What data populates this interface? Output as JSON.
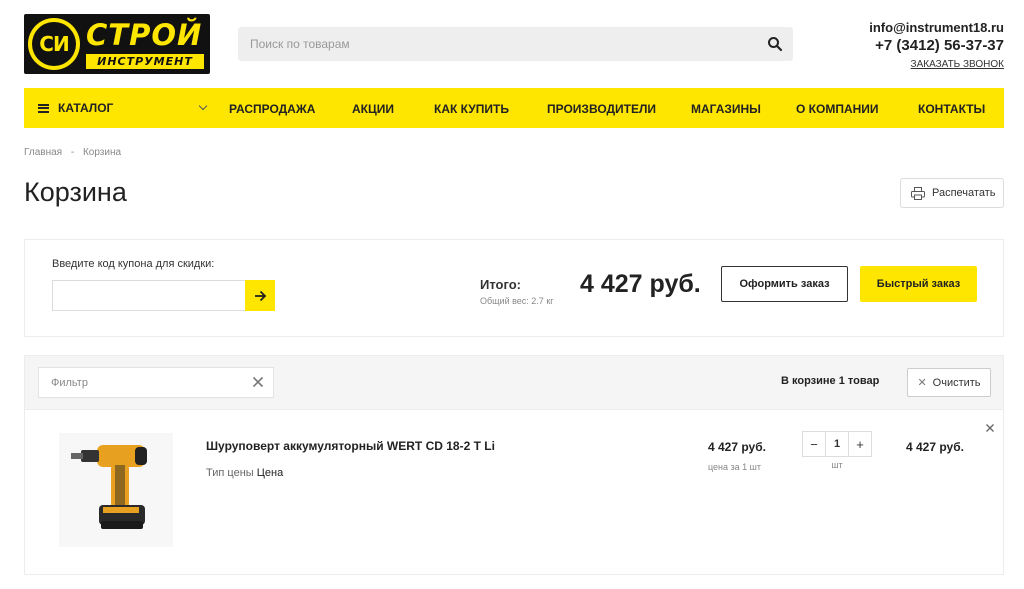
{
  "logo": {
    "emblem": "СИ",
    "line1": "СТРОЙ",
    "line2": "ИНСТРУМЕНТ"
  },
  "search": {
    "placeholder": "Поиск по товарам",
    "icon": "search-icon"
  },
  "contacts": {
    "email": "info@instrument18.ru",
    "phone": "+7 (3412) 56-37-37",
    "callback": "ЗАКАЗАТЬ ЗВОНОК"
  },
  "nav": {
    "catalog": "КАТАЛОГ",
    "items": [
      "РАСПРОДАЖА",
      "АКЦИИ",
      "КАК КУПИТЬ",
      "ПРОИЗВОДИТЕЛИ",
      "МАГАЗИНЫ",
      "О КОМПАНИИ",
      "КОНТАКТЫ"
    ]
  },
  "breadcrumb": {
    "home": "Главная",
    "separator": "-",
    "current": "Корзина"
  },
  "page": {
    "title": "Корзина",
    "print": "Распечатать"
  },
  "coupon": {
    "label": "Введите код купона для скидки:",
    "value": ""
  },
  "summary": {
    "total_label": "Итого:",
    "weight": "Общий вес: 2.7 кг",
    "total": "4 427 руб.",
    "checkout": "Оформить заказ",
    "quick": "Быстрый заказ"
  },
  "cart": {
    "filter_placeholder": "Фильтр",
    "count_text": "В корзине 1 товар",
    "clear": "Очистить",
    "items": [
      {
        "name": "Шуруповерт аккумуляторный WERT CD 18-2 T Li",
        "price_type_label": "Тип цены",
        "price_type": "Цена",
        "price": "4 427 руб.",
        "price_note": "цена за 1 шт",
        "qty": "1",
        "unit": "шт",
        "sum": "4 427 руб."
      }
    ]
  },
  "colors": {
    "accent": "#ffe600",
    "text": "#222222"
  }
}
